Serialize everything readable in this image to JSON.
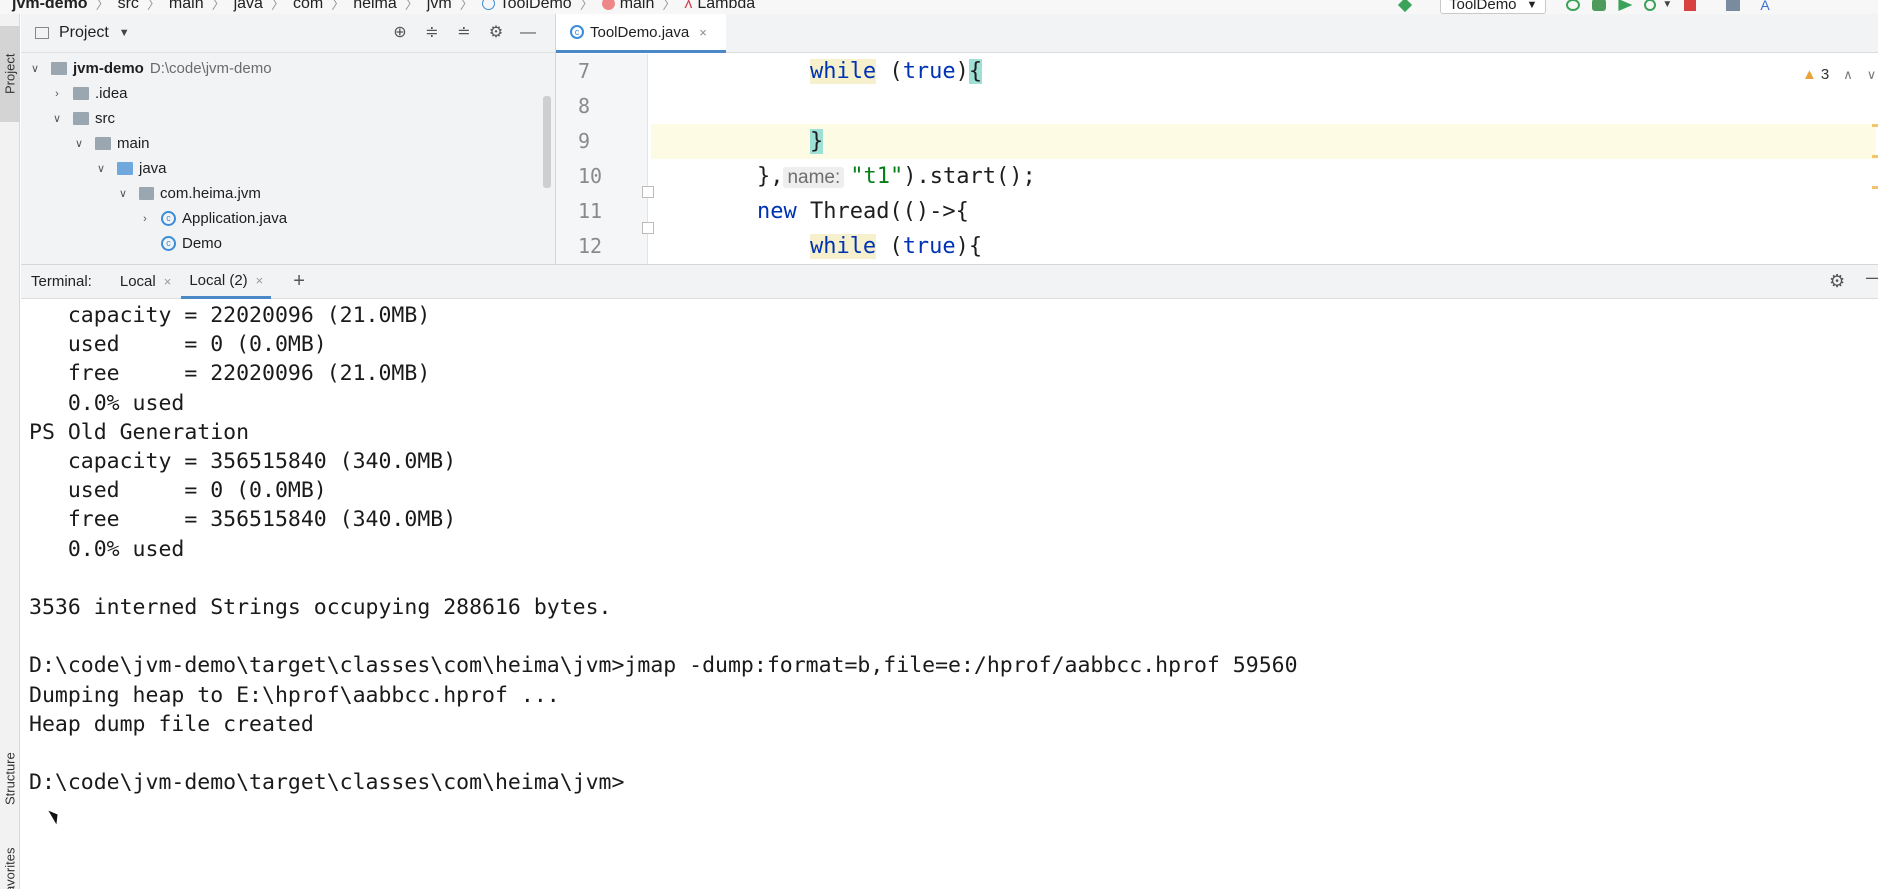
{
  "breadcrumbs": [
    "jvm-demo",
    "src",
    "main",
    "java",
    "com",
    "heima",
    "jvm",
    "ToolDemo",
    "main",
    "Lambda"
  ],
  "toolbar": {
    "run_config": "ToolDemo",
    "icons": [
      "build-icon",
      "rerun-icon",
      "debug-icon",
      "coverage-icon",
      "profile-icon",
      "stop-icon",
      "vcs-icon",
      "translate-icon"
    ]
  },
  "left_strip": {
    "project": "Project",
    "structure": "Structure",
    "favorites": "Favorites"
  },
  "project_panel": {
    "title": "Project",
    "tree": [
      {
        "label": "jvm-demo",
        "path": "D:\\code\\jvm-demo",
        "level": 0,
        "expanded": true,
        "kind": "module"
      },
      {
        "label": ".idea",
        "level": 1,
        "expanded": false,
        "kind": "folder"
      },
      {
        "label": "src",
        "level": 1,
        "expanded": true,
        "kind": "folder"
      },
      {
        "label": "main",
        "level": 2,
        "expanded": true,
        "kind": "folder"
      },
      {
        "label": "java",
        "level": 3,
        "expanded": true,
        "kind": "source-folder"
      },
      {
        "label": "com.heima.jvm",
        "level": 4,
        "expanded": true,
        "kind": "package"
      },
      {
        "label": "Application.java",
        "level": 5,
        "expanded": false,
        "kind": "class"
      },
      {
        "label": "Demo",
        "level": 5,
        "expanded": null,
        "kind": "class"
      }
    ]
  },
  "editor": {
    "tab": "ToolDemo.java",
    "warnings": "3",
    "lines": [
      {
        "no": "7",
        "seg": [
          [
            "",
            "            "
          ],
          [
            "kw-hl",
            "while"
          ],
          [
            "",
            " ("
          ],
          [
            "kw",
            "true"
          ],
          [
            "",
            ")"
          ],
          [
            "brace-hl",
            "{"
          ]
        ]
      },
      {
        "no": "8",
        "seg": [
          [
            "",
            ""
          ]
        ]
      },
      {
        "no": "9",
        "seg": [
          [
            "",
            "            "
          ],
          [
            "brace-hl",
            "}"
          ]
        ],
        "current": true
      },
      {
        "no": "10",
        "seg": [
          [
            "",
            "        },"
          ],
          [
            "hint",
            "name:"
          ],
          [
            "str",
            "\"t1\""
          ],
          [
            "",
            ").start();"
          ]
        ]
      },
      {
        "no": "11",
        "seg": [
          [
            "",
            "        "
          ],
          [
            "kw",
            "new"
          ],
          [
            "",
            " Thread(()->{"
          ]
        ]
      },
      {
        "no": "12",
        "seg": [
          [
            "",
            "            "
          ],
          [
            "kw-hl",
            "while"
          ],
          [
            "",
            " ("
          ],
          [
            "kw",
            "true"
          ],
          [
            "",
            "){"
          ]
        ]
      }
    ]
  },
  "terminal": {
    "label": "Terminal:",
    "tabs": [
      "Local",
      "Local (2)"
    ],
    "active_tab": "Local (2)",
    "output": [
      "   capacity = 22020096 (21.0MB)",
      "   used     = 0 (0.0MB)",
      "   free     = 22020096 (21.0MB)",
      "   0.0% used",
      "PS Old Generation",
      "   capacity = 356515840 (340.0MB)",
      "   used     = 0 (0.0MB)",
      "   free     = 356515840 (340.0MB)",
      "   0.0% used",
      "",
      "3536 interned Strings occupying 288616 bytes.",
      "",
      "D:\\code\\jvm-demo\\target\\classes\\com\\heima\\jvm>jmap -dump:format=b,file=e:/hprof/aabbcc.hprof 59560",
      "Dumping heap to E:\\hprof\\aabbcc.hprof ...",
      "Heap dump file created",
      "",
      "D:\\code\\jvm-demo\\target\\classes\\com\\heima\\jvm>"
    ]
  }
}
